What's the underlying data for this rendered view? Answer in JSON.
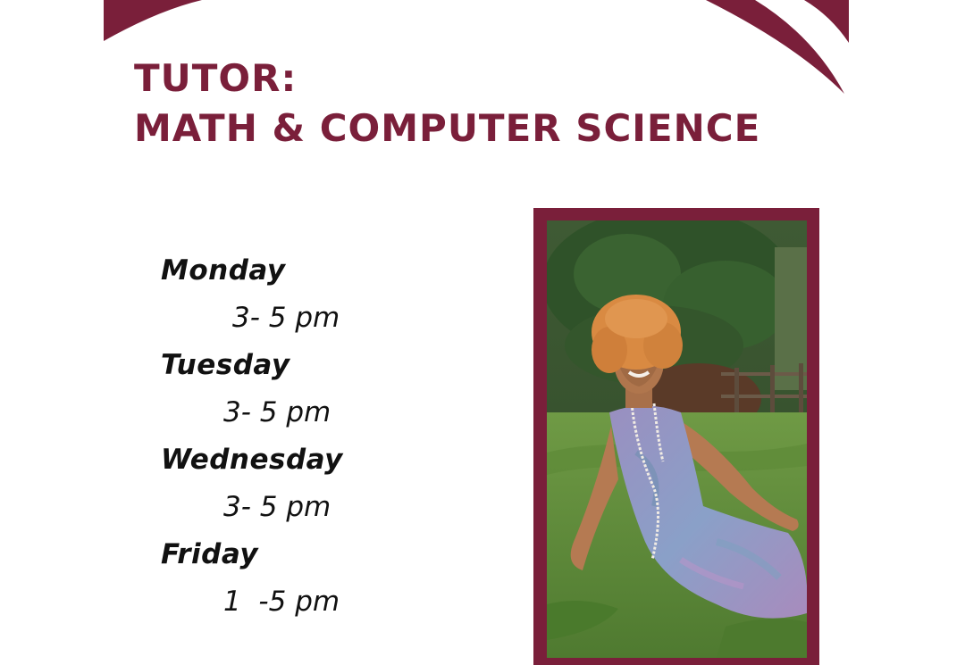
{
  "flyer": {
    "title_line1": "TUTOR:",
    "title_line2": "MATH & COMPUTER SCIENCE",
    "accent_color": "#7a1f3a",
    "schedule": [
      {
        "day": "Monday",
        "time": "3- 5 pm"
      },
      {
        "day": "Tuesday",
        "time": "3- 5 pm"
      },
      {
        "day": "Wednesday",
        "time": "3- 5 pm"
      },
      {
        "day": "Friday",
        "time": "1  -5 pm"
      }
    ],
    "photo_icon": "tutor-portrait-photo"
  }
}
